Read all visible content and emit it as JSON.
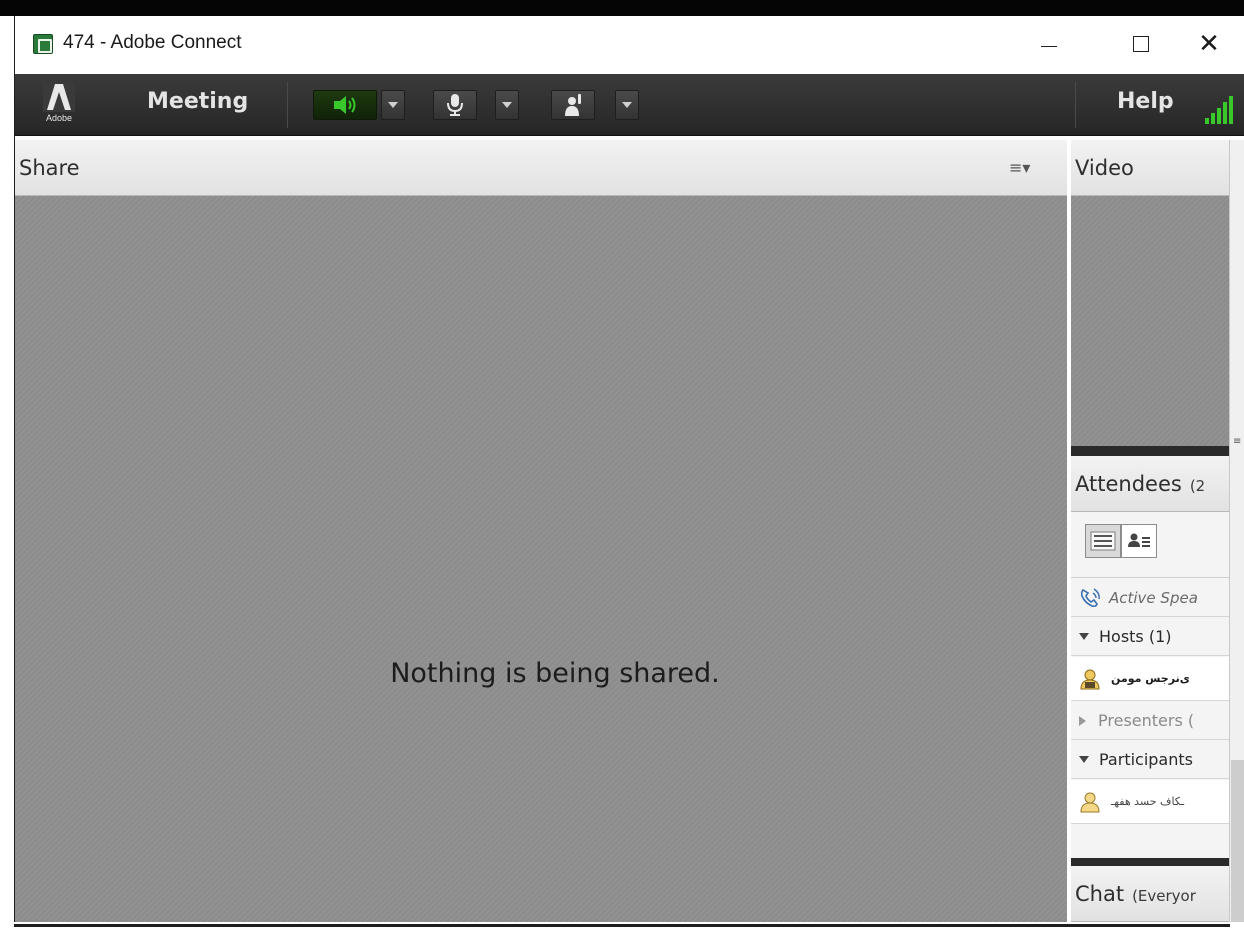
{
  "window": {
    "title": "474 - Adobe Connect",
    "app_icon": "adobe-connect-icon",
    "controls": [
      "minimize-icon",
      "maximize-icon",
      "close-icon"
    ]
  },
  "toolbar": {
    "logo_text": "Adobe",
    "menu_meeting": "Meeting",
    "menu_help": "Help",
    "speaker_state": "on",
    "accent_green": "#39c82a",
    "icons": [
      "speaker-icon",
      "microphone-icon",
      "raise-hand-icon",
      "signal-strength-icon"
    ]
  },
  "share_pod": {
    "title": "Share",
    "menu_icon": "pod-options-icon",
    "empty_message": "Nothing is being shared."
  },
  "video_pod": {
    "title": "Video"
  },
  "attendees_pod": {
    "title": "Attendees",
    "count_fragment": "(2",
    "view_icons": [
      "list-view-icon",
      "attendee-status-view-icon"
    ],
    "active_speakers": "Active Spea",
    "groups": [
      {
        "label": "Hosts (1)",
        "expanded": true
      },
      {
        "label": "Presenters (",
        "expanded": false
      },
      {
        "label": "Participants",
        "expanded": true
      }
    ],
    "host_name": "ی‌نرجس مومن",
    "participant_name": "ـکاف حسد هفهـ"
  },
  "chat_pod": {
    "title": "Chat",
    "scope": "(Everyor"
  }
}
